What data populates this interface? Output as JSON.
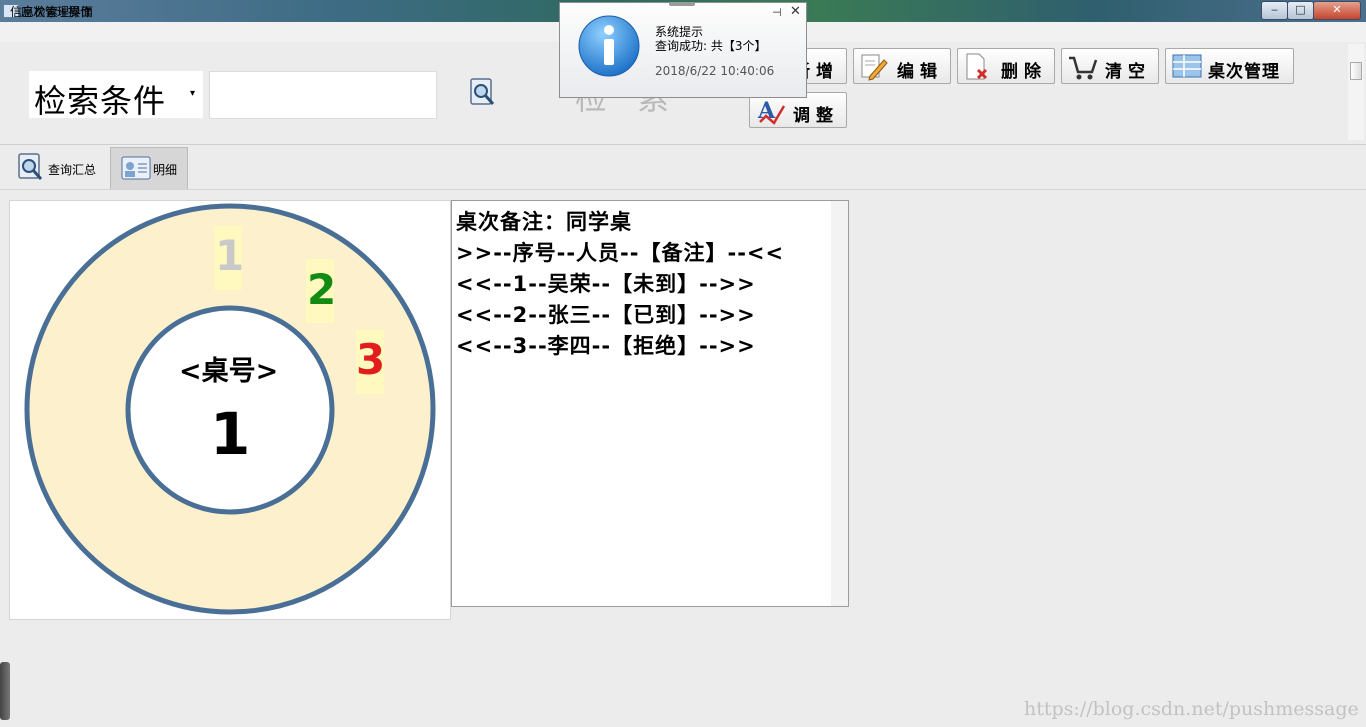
{
  "window": {
    "title": "座次管理界面",
    "min": "‒",
    "max": "□",
    "close": "✕"
  },
  "menu": {
    "item": "信息检索+操作"
  },
  "search": {
    "condition_label": "检索条件",
    "condition_arrow": "▾",
    "query": "",
    "search_label": "检 索"
  },
  "toolbar": {
    "add": "新增",
    "edit": "编辑",
    "delete": "删除",
    "clear": "清空",
    "table_manage": "桌次管理",
    "adjust": "调整"
  },
  "tabs": [
    {
      "label": "查询汇总"
    },
    {
      "label": "明细"
    }
  ],
  "seating": {
    "table_title": "<桌号>",
    "table_number": "1",
    "seats": [
      {
        "number": "1",
        "color": "#c9c9c9",
        "status": "未到"
      },
      {
        "number": "2",
        "color": "#138a13",
        "status": "已到"
      },
      {
        "number": "3",
        "color": "#e11d1d",
        "status": "拒绝"
      }
    ],
    "colors": {
      "ring_fill": "#fdf1cd",
      "ring_stroke": "#4a6f96",
      "seat_highlight": "#fff9c0"
    }
  },
  "notes": {
    "lines": [
      "桌次备注：同学桌",
      ">>--序号--人员--【备注】--<<",
      "<<--1--吴荣--【未到】-->>",
      "<<--2--张三--【已到】-->>",
      "<<--3--李四--【拒绝】-->>"
    ]
  },
  "toast": {
    "title": "系统提示",
    "message": "查询成功: 共【3个】",
    "time": "2018/6/22 10:40:06",
    "pin": "⊣",
    "close": "✕"
  },
  "watermark": "https://blog.csdn.net/pushmessage"
}
